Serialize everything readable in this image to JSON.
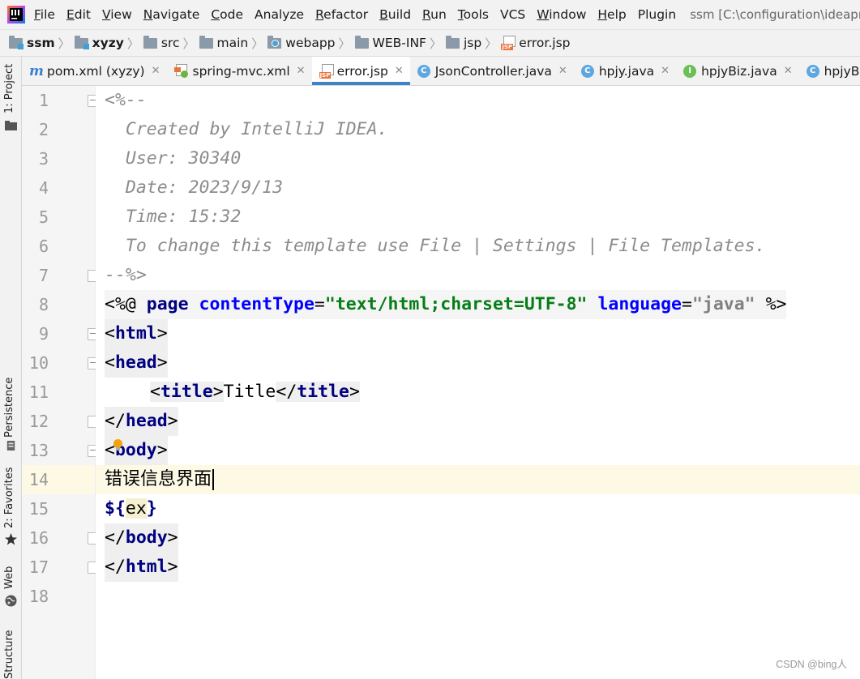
{
  "window": {
    "title": "ssm [C:\\configuration\\ideapro"
  },
  "menu": {
    "items": [
      {
        "label": "File",
        "mnemonic": "F",
        "rest": "ile"
      },
      {
        "label": "Edit",
        "mnemonic": "E",
        "rest": "dit"
      },
      {
        "label": "View",
        "mnemonic": "V",
        "rest": "iew"
      },
      {
        "label": "Navigate",
        "mnemonic": "N",
        "rest": "avigate"
      },
      {
        "label": "Code",
        "mnemonic": "C",
        "rest": "ode"
      },
      {
        "label": "Analyze",
        "mnemonic": "",
        "rest": "Analyze"
      },
      {
        "label": "Refactor",
        "mnemonic": "R",
        "rest": "efactor"
      },
      {
        "label": "Build",
        "mnemonic": "B",
        "rest": "uild"
      },
      {
        "label": "Run",
        "mnemonic": "R",
        "rest": "un"
      },
      {
        "label": "Tools",
        "mnemonic": "T",
        "rest": "ools"
      },
      {
        "label": "VCS",
        "mnemonic": "",
        "rest": "VCS"
      },
      {
        "label": "Window",
        "mnemonic": "W",
        "rest": "indow"
      },
      {
        "label": "Help",
        "mnemonic": "H",
        "rest": "elp"
      },
      {
        "label": "Plugin",
        "mnemonic": "",
        "rest": "Plugin"
      }
    ]
  },
  "breadcrumb": {
    "items": [
      {
        "label": "ssm",
        "icon": "module-folder-icon"
      },
      {
        "label": "xyzy",
        "icon": "module-folder-icon"
      },
      {
        "label": "src",
        "icon": "folder-icon"
      },
      {
        "label": "main",
        "icon": "folder-icon"
      },
      {
        "label": "webapp",
        "icon": "web-folder-icon"
      },
      {
        "label": "WEB-INF",
        "icon": "folder-icon"
      },
      {
        "label": "jsp",
        "icon": "folder-icon"
      },
      {
        "label": "error.jsp",
        "icon": "jsp-file-icon"
      }
    ]
  },
  "toolstrip": {
    "project": "1: Project",
    "persistence": "Persistence",
    "favorites": "2: Favorites",
    "web": "Web",
    "structure": "Structure"
  },
  "tabs": [
    {
      "label": "pom.xml (xyzy)",
      "icon": "maven-icon",
      "active": false
    },
    {
      "label": "spring-mvc.xml",
      "icon": "spring-xml-icon",
      "active": false
    },
    {
      "label": "error.jsp",
      "icon": "jsp-file-icon",
      "active": true
    },
    {
      "label": "JsonController.java",
      "icon": "class-icon",
      "glyph": "C",
      "active": false
    },
    {
      "label": "hpjy.java",
      "icon": "class-icon",
      "glyph": "C",
      "active": false
    },
    {
      "label": "hpjyBiz.java",
      "icon": "interface-icon",
      "glyph": "I",
      "active": false
    },
    {
      "label": "hpjyBizImp",
      "icon": "class-icon",
      "glyph": "C",
      "active": false
    }
  ],
  "editor": {
    "current_line": 14,
    "lines": [
      {
        "n": "1",
        "code": "<%--"
      },
      {
        "n": "2",
        "code": "  Created by IntelliJ IDEA."
      },
      {
        "n": "3",
        "code": "  User: 30340"
      },
      {
        "n": "4",
        "code": "  Date: 2023/9/13"
      },
      {
        "n": "5",
        "code": "  Time: 15:32"
      },
      {
        "n": "6",
        "code": "  To change this template use File | Settings | File Templates."
      },
      {
        "n": "7",
        "code": "--%>"
      },
      {
        "n": "8",
        "code": "<%@ page contentType=\"text/html;charset=UTF-8\" language=\"java\" %>"
      },
      {
        "n": "9",
        "code": "<html>"
      },
      {
        "n": "10",
        "code": "<head>"
      },
      {
        "n": "11",
        "code": "    <title>Title</title>"
      },
      {
        "n": "12",
        "code": "</head>"
      },
      {
        "n": "13",
        "code": "<body>"
      },
      {
        "n": "14",
        "code": "错误信息界面"
      },
      {
        "n": "15",
        "code": "${ex}"
      },
      {
        "n": "16",
        "code": "</body>"
      },
      {
        "n": "17",
        "code": "</html>"
      },
      {
        "n": "18",
        "code": ""
      }
    ],
    "tokens": {
      "l1": "<%--",
      "l2": "  Created by IntelliJ IDEA.",
      "l3": "  User: 30340",
      "l4": "  Date: 2023/9/13",
      "l5": "  Time: 15:32",
      "l6": "  To change this template use File | Settings | File Templates.",
      "l7": "--%>",
      "l8_open": "<%@",
      "l8_page": "page",
      "l8_attr1": "contentType",
      "l8_eq": "=",
      "l8_val1": "\"text/html;charset=UTF-8\"",
      "l8_attr2": "language",
      "l8_val2": "\"java\"",
      "l8_close": "%>",
      "lt": "<",
      "gt": ">",
      "lts": "</",
      "html": "html",
      "head": "head",
      "title": "title",
      "title_text": "Title",
      "body": "body",
      "l14": "错误信息界面",
      "el_open": "${",
      "el_var": "ex",
      "el_close": "}"
    }
  },
  "watermark": "CSDN @bing人"
}
